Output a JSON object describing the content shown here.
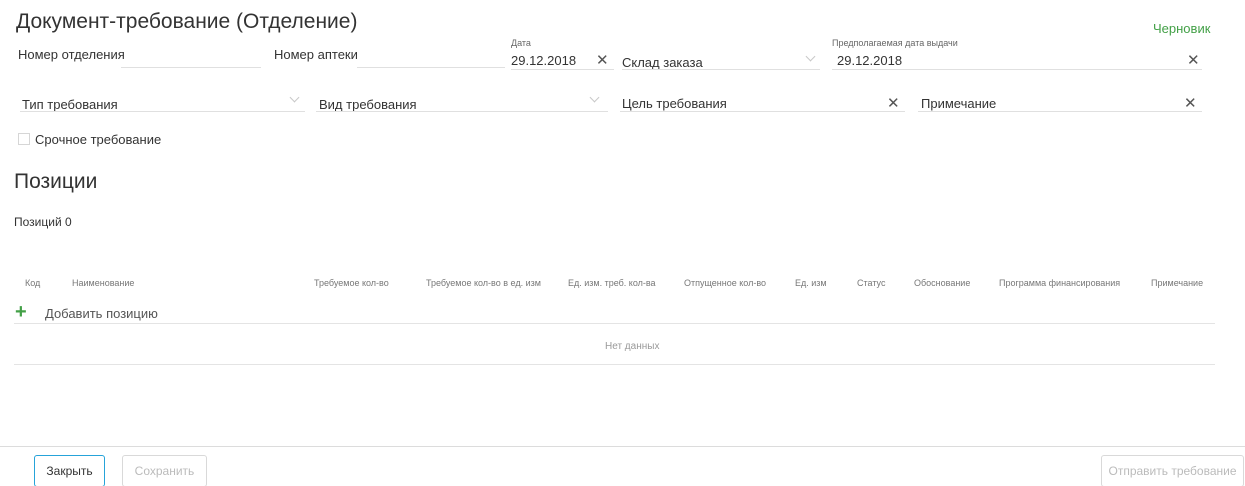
{
  "header": {
    "title": "Документ-требование (Отделение)",
    "status": "Черновик"
  },
  "form": {
    "department_number": {
      "label": "Номер отделения",
      "value": ""
    },
    "pharmacy_number": {
      "label": "Номер аптеки",
      "value": ""
    },
    "date": {
      "label": "Дата",
      "value": "29.12.2018"
    },
    "order_warehouse": {
      "label": "Склад заказа",
      "value": ""
    },
    "expected_issue_date": {
      "label": "Предполагаемая дата выдачи",
      "value": "29.12.2018"
    },
    "request_type": {
      "label": "Тип требования",
      "value": ""
    },
    "request_kind": {
      "label": "Вид требования",
      "value": ""
    },
    "request_purpose": {
      "label": "Цель требования",
      "value": ""
    },
    "note": {
      "label": "Примечание",
      "value": ""
    },
    "urgent": {
      "label": "Срочное требование",
      "checked": false
    }
  },
  "positions": {
    "title": "Позиции",
    "count_text": "Позиций 0",
    "columns": [
      "Код",
      "Наименование",
      "Требуемое кол-во",
      "Требуемое кол-во в ед. изм",
      "Ед. изм. треб. кол-ва",
      "Отпущенное кол-во",
      "Ед. изм",
      "Статус",
      "Обоснование",
      "Программа финансирования",
      "Примечание"
    ],
    "add_label": "Добавить позицию",
    "add_icon": "+",
    "empty_text": "Нет данных"
  },
  "footer": {
    "close_label": "Закрыть",
    "save_label": "Сохранить",
    "send_label": "Отправить требование"
  },
  "colors": {
    "status_green": "#43a047",
    "primary_border": "#26a3d9"
  }
}
